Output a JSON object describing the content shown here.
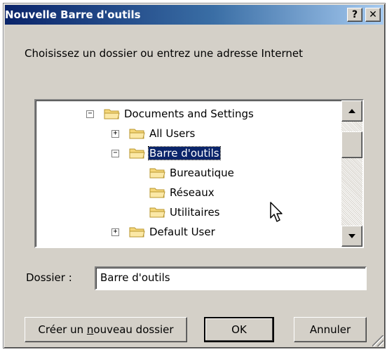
{
  "dialog": {
    "title": "Nouvelle Barre d'outils",
    "help_glyph": "?",
    "close_glyph": "✕"
  },
  "prompt": "Choisissez un dossier ou entrez une adresse Internet",
  "tree": {
    "items": [
      {
        "label": "Documents and Settings",
        "expander": "−",
        "selected": false
      },
      {
        "label": "All Users",
        "expander": "+",
        "selected": false
      },
      {
        "label": "Barre d'outils",
        "expander": "−",
        "selected": true
      },
      {
        "label": "Bureautique",
        "expander": "",
        "selected": false
      },
      {
        "label": "Réseaux",
        "expander": "",
        "selected": false
      },
      {
        "label": "Utilitaires",
        "expander": "",
        "selected": false
      },
      {
        "label": "Default User",
        "expander": "+",
        "selected": false
      }
    ]
  },
  "folder_field": {
    "label": "Dossier :",
    "value": "Barre d'outils"
  },
  "buttons": {
    "new_folder_before": "Créer un ",
    "new_folder_mnemonic": "n",
    "new_folder_after": "ouveau dossier",
    "ok": "OK",
    "cancel": "Annuler"
  },
  "colors": {
    "titlebar_start": "#0a246a",
    "titlebar_end": "#a6caf0",
    "face": "#d4d0c8",
    "folder_fill": "#f5d77a",
    "folder_stroke": "#b8962e",
    "selection": "#0a246a"
  }
}
